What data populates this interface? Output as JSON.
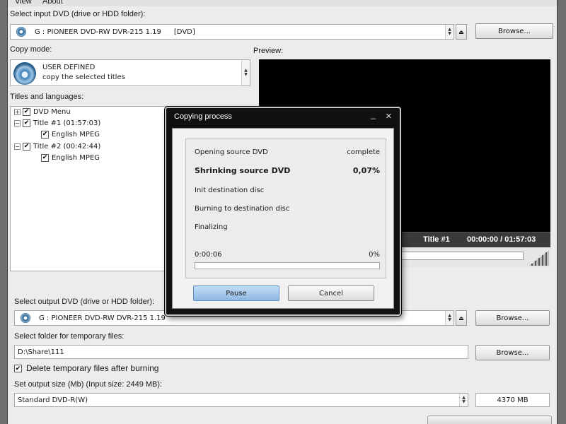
{
  "menu": {
    "view": "View",
    "about": "About"
  },
  "input": {
    "label": "Select input DVD (drive or HDD folder):",
    "drive": "G : PIONEER  DVD-RW  DVR-215  1.19",
    "drive_type": "[DVD]",
    "browse": "Browse..."
  },
  "copy_mode": {
    "label": "Copy mode:",
    "title": "USER DEFINED",
    "subtitle": "copy the selected titles"
  },
  "preview": {
    "label": "Preview:",
    "title": "Title #1",
    "time": "00:00:00 / 01:57:03"
  },
  "titles": {
    "label": "Titles and languages:",
    "items": [
      {
        "text": "DVD Menu"
      },
      {
        "text": "Title #1 (01:57:03)"
      },
      {
        "text": "English MPEG"
      },
      {
        "text": "Title #2 (00:42:44)"
      },
      {
        "text": "English MPEG"
      }
    ]
  },
  "dialog": {
    "title": "Copying process",
    "minimize": "_",
    "close": "✕",
    "steps": [
      {
        "name": "Opening source DVD",
        "status": "complete"
      },
      {
        "name": "Shrinking source DVD",
        "status": "0,07%"
      },
      {
        "name": "Init destination disc",
        "status": ""
      },
      {
        "name": "Burning to destination disc",
        "status": ""
      },
      {
        "name": "Finalizing",
        "status": ""
      }
    ],
    "elapsed": "0:00:06",
    "percent": "0%",
    "progress_fraction": 0.0,
    "pause": "Pause",
    "cancel": "Cancel"
  },
  "output": {
    "label": "Select output DVD (drive or HDD folder):",
    "drive": "G : PIONEER  DVD-RW  DVR-215  1.19",
    "browse": "Browse..."
  },
  "temp": {
    "label": "Select folder for temporary files:",
    "path": "D:\\Share\\111",
    "browse": "Browse...",
    "delete_label": "Delete temporary files after burning",
    "delete_checked": true
  },
  "size": {
    "label": "Set output size (Mb) (Input size: 2449 MB):",
    "value": "Standard DVD-R(W)",
    "mb": "4370 MB"
  },
  "colors": {
    "accent_button": "#9cc4ec",
    "preview_bg": "#000000",
    "dialog_frame": "#111111"
  }
}
